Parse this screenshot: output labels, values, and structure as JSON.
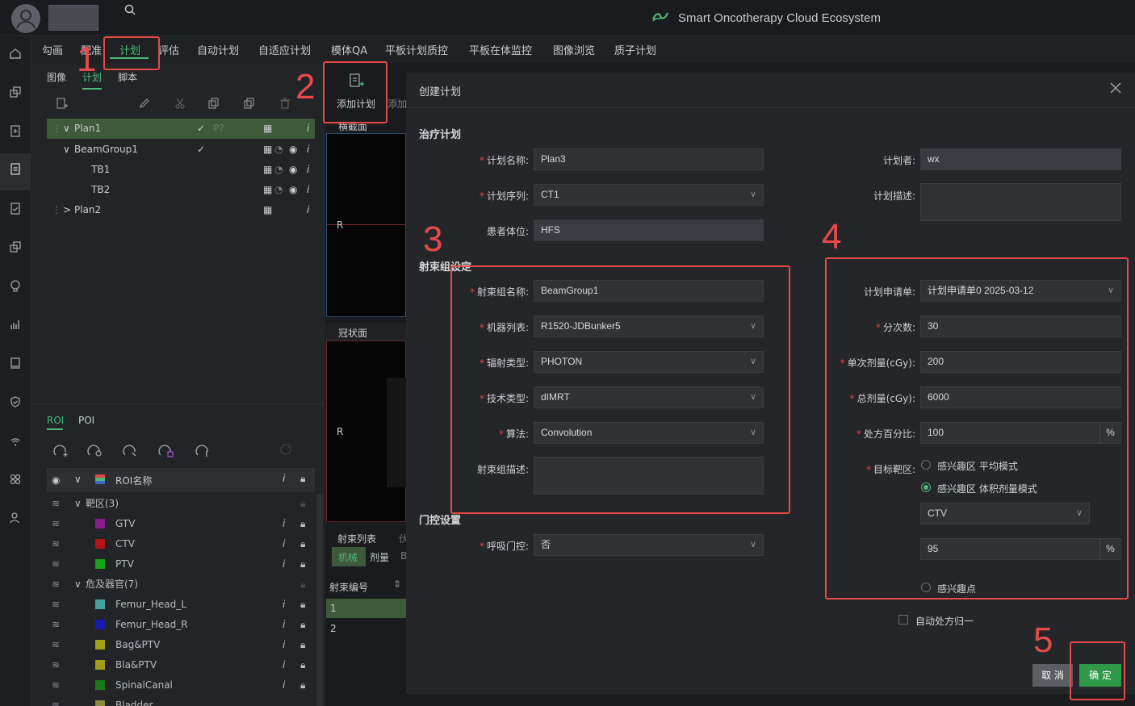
{
  "app": {
    "brand_title": "Smart Oncotherapy Cloud Ecosystem",
    "brand_color": "#4fb878"
  },
  "icons": [
    "user-avatar-icon",
    "search-icon",
    "home-icon",
    "layers-icon",
    "clipboard-plus-icon",
    "clipboard-icon",
    "chart-icon",
    "shield-icon",
    "people-icon",
    "close-icon",
    "chevron-down-icon"
  ],
  "menu": {
    "items": [
      "勾画",
      "配准",
      "计划",
      "评估",
      "自动计划",
      "自适应计划",
      "模体QA",
      "平板计划质控",
      "平板在体监控",
      "图像浏览",
      "质子计划"
    ],
    "active": "计划"
  },
  "subtabs": [
    "图像",
    "计划",
    "脚本"
  ],
  "plan_tree": [
    {
      "label": "Plan1",
      "selected": true
    },
    {
      "label": "BeamGroup1"
    },
    {
      "label": "TB1"
    },
    {
      "label": "TB2"
    },
    {
      "label": "Plan2"
    }
  ],
  "roi_tabs": [
    "ROI",
    "POI"
  ],
  "roi": {
    "header": "ROI名称",
    "groups": {
      "target": "靶区(3)",
      "oar": "危及器官(7)"
    },
    "items": [
      {
        "name": "GTV",
        "color": "#8b1b8b"
      },
      {
        "name": "CTV",
        "color": "#b01515"
      },
      {
        "name": "PTV",
        "color": "#18a218"
      },
      {
        "name": "Femur_Head_L",
        "color": "#4aa0a0"
      },
      {
        "name": "Femur_Head_R",
        "color": "#1a1ab0"
      },
      {
        "name": "Bag&PTV",
        "color": "#a0a018"
      },
      {
        "name": "Bla&PTV",
        "color": "#a0a018"
      },
      {
        "name": "SpinalCanal",
        "color": "#1a7a1a"
      },
      {
        "name": "Bladder",
        "color": "#8a8a40"
      }
    ]
  },
  "viewer": {
    "add_plan_label": "添加计划",
    "add_plan_partial": "添加",
    "view1": "横截面",
    "view2": "冠状面",
    "r_marker": "R",
    "beam_list_title": "射束列表",
    "beam_tabs": [
      "机械",
      "剂量"
    ],
    "beam_tab_partial": "B",
    "beam_col": "射束编号",
    "beam_rows": [
      "1",
      "2"
    ]
  },
  "dialog": {
    "title": "创建计划",
    "section_treatment": "治疗计划",
    "section_beam": "射束组设定",
    "section_gating": "门控设置",
    "plan_name_label": "计划名称:",
    "plan_name": "Plan3",
    "planner_label": "计划者:",
    "planner": "wx",
    "plan_series_label": "计划序列:",
    "plan_series": "CT1",
    "plan_desc_label": "计划描述:",
    "patient_pos_label": "患者体位:",
    "patient_pos": "HFS",
    "beam_group_name_label": "射束组名称:",
    "beam_group_name": "BeamGroup1",
    "machine_label": "机器列表:",
    "machine": "R1520-JDBunker5",
    "radiation_label": "辐射类型:",
    "radiation": "PHOTON",
    "technique_label": "技术类型:",
    "technique": "dIMRT",
    "algorithm_label": "算法:",
    "algorithm": "Convolution",
    "beam_desc_label": "射束组描述:",
    "gating_label": "呼吸门控:",
    "gating": "否",
    "request_label": "计划申请单:",
    "request": "计划申请单0 2025-03-12",
    "fractions_label": "分次数:",
    "fractions": "30",
    "dose_per_label": "单次剂量(cGy):",
    "dose_per": "200",
    "total_dose_label": "总剂量(cGy):",
    "total_dose": "6000",
    "rx_percent_label": "处方百分比:",
    "rx_percent": "100",
    "percent_unit": "%",
    "target_label": "目标靶区:",
    "target_opt1": "感兴趣区 平均模式",
    "target_opt2": "感兴趣区 体积剂量模式",
    "target_roi": "CTV",
    "target_volume": "95",
    "target_opt3": "感兴趣点",
    "auto_normalize": "自动处方归一",
    "cancel": "取 消",
    "confirm": "确 定"
  },
  "annotations": {
    "labels": [
      "1",
      "2",
      "3",
      "4",
      "5"
    ],
    "color": "#e64a4a"
  }
}
